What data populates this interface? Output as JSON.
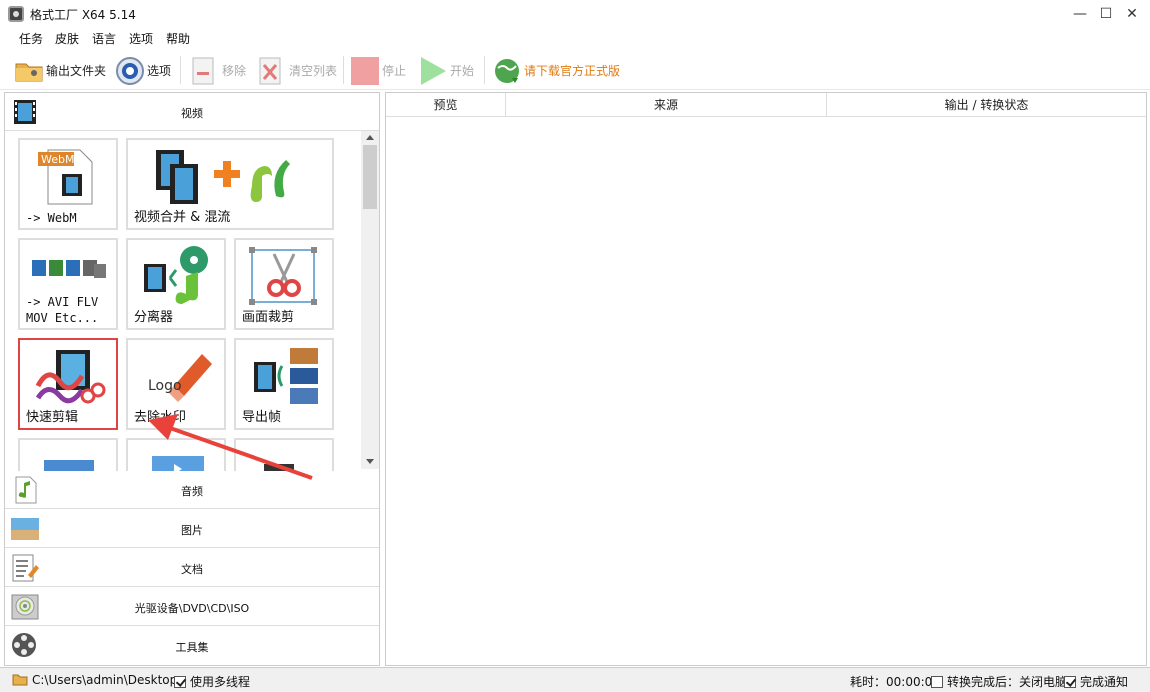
{
  "window": {
    "title": "格式工厂 X64 5.14",
    "minimize": "—",
    "maximize": "☐",
    "close": "✕"
  },
  "menu": [
    "任务",
    "皮肤",
    "语言",
    "选项",
    "帮助"
  ],
  "toolbar": {
    "output_folder": "输出文件夹",
    "options": "选项",
    "remove": "移除",
    "clear_list": "清空列表",
    "stop": "停止",
    "start": "开始",
    "download_official": "请下载官方正式版"
  },
  "left": {
    "categories": {
      "video": "视频",
      "audio": "音频",
      "image": "图片",
      "document": "文档",
      "disc": "光驱设备\\DVD\\CD\\ISO",
      "tools": "工具集"
    },
    "tiles": {
      "webm": "-> WebM",
      "merge": "视频合并 & 混流",
      "avi": "-> AVI FLV\nMOV Etc...",
      "splitter": "分离器",
      "crop": "画面裁剪",
      "quick_cut": "快速剪辑",
      "remove_watermark": "去除水印",
      "export_frames": "导出帧"
    }
  },
  "right": {
    "columns": [
      "预览",
      "来源",
      "输出 / 转换状态"
    ]
  },
  "status": {
    "path": "C:\\Users\\admin\\Desktop",
    "multithread": "使用多线程",
    "time_label": "耗时：00:00:00",
    "after_convert": "转换完成后：关闭电脑",
    "notify": "完成通知"
  },
  "colors": {
    "highlight": "#e04545",
    "accent_orange": "#f08020"
  }
}
